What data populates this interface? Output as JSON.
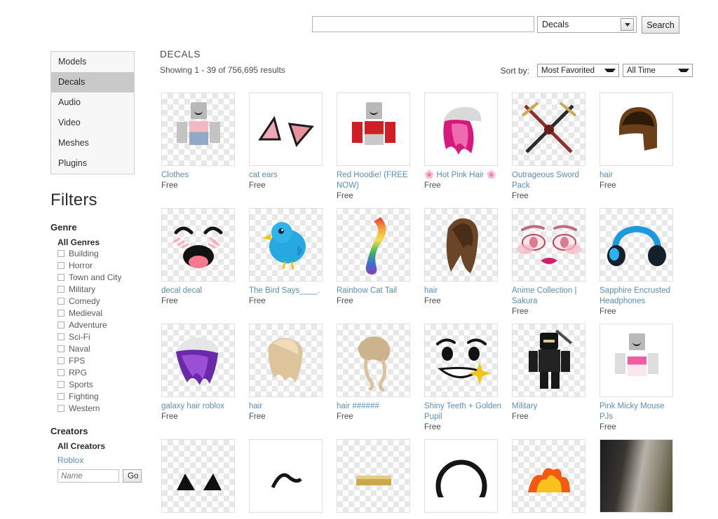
{
  "search": {
    "query_value": "",
    "query_placeholder": "",
    "category_selected": "Decals",
    "search_button_label": "Search"
  },
  "sidebar": {
    "categories": [
      {
        "label": "Models",
        "active": false
      },
      {
        "label": "Decals",
        "active": true
      },
      {
        "label": "Audio",
        "active": false
      },
      {
        "label": "Video",
        "active": false
      },
      {
        "label": "Meshes",
        "active": false
      },
      {
        "label": "Plugins",
        "active": false
      }
    ],
    "filters_heading": "Filters",
    "genre": {
      "title": "Genre",
      "all_label": "All Genres",
      "options": [
        "Building",
        "Horror",
        "Town and City",
        "Military",
        "Comedy",
        "Medieval",
        "Adventure",
        "Sci-Fi",
        "Naval",
        "FPS",
        "RPG",
        "Sports",
        "Fighting",
        "Western"
      ]
    },
    "creators": {
      "title": "Creators",
      "all_label": "All Creators",
      "roblox_link": "Roblox",
      "name_placeholder": "Name",
      "name_value": "",
      "go_label": "Go"
    }
  },
  "main": {
    "title": "DECALS",
    "results_text": "Showing 1 - 39 of 756,695 results",
    "sort_label": "Sort by:",
    "sort_selected": "Most Favorited",
    "time_selected": "All Time"
  },
  "items": [
    {
      "name": "Clothes",
      "price": "Free",
      "art": "avatar-pink-shirt",
      "checker": true
    },
    {
      "name": "cat ears",
      "price": "Free",
      "art": "cat-ears",
      "checker": false
    },
    {
      "name": "Red Hoodie! (FREE NOW)",
      "price": "Free",
      "art": "avatar-red-hoodie",
      "checker": false
    },
    {
      "name": "🌸 Hot Pink Hair 🌸",
      "price": "Free",
      "art": "pink-hair",
      "checker": false
    },
    {
      "name": "Outrageous Sword Pack",
      "price": "Free",
      "art": "crossed-swords",
      "checker": true
    },
    {
      "name": "hair",
      "price": "Free",
      "art": "brown-bob-hair",
      "checker": false
    },
    {
      "name": "decal decal",
      "price": "Free",
      "art": "kawaii-face",
      "checker": true
    },
    {
      "name": "The Bird Says____.",
      "price": "Free",
      "art": "blue-bird",
      "checker": true
    },
    {
      "name": "Rainbow Cat Tail",
      "price": "Free",
      "art": "rainbow-tail",
      "checker": true
    },
    {
      "name": "hair",
      "price": "Free",
      "art": "long-brown-hair",
      "checker": true
    },
    {
      "name": "Anime Collection | Sakura",
      "price": "Free",
      "art": "anime-eyes",
      "checker": true
    },
    {
      "name": "Sapphire Encrusted Headphones",
      "price": "Free",
      "art": "blue-headphones",
      "checker": true
    },
    {
      "name": "galaxy hair roblox",
      "price": "Free",
      "art": "purple-beanie-hair",
      "checker": true
    },
    {
      "name": "hair",
      "price": "Free",
      "art": "blonde-hair",
      "checker": true
    },
    {
      "name": "hair ######",
      "price": "Free",
      "art": "blonde-curly-hair",
      "checker": true
    },
    {
      "name": "Shiny Teeth + Golden Pupil",
      "price": "Free",
      "art": "shiny-teeth-face",
      "checker": true
    },
    {
      "name": "Military",
      "price": "Free",
      "art": "ninja-avatar",
      "checker": true
    },
    {
      "name": "Pink Micky Mouse PJs",
      "price": "Free",
      "art": "avatar-pink-pjs",
      "checker": false
    }
  ],
  "partial_row": [
    {
      "art": "black-cat-ears",
      "checker": true
    },
    {
      "art": "black-shape",
      "checker": false
    },
    {
      "art": "gold-item",
      "checker": true
    },
    {
      "art": "black-ring",
      "checker": false
    },
    {
      "art": "flame",
      "checker": true
    },
    {
      "art": "photo-dog",
      "checker": false
    }
  ]
}
